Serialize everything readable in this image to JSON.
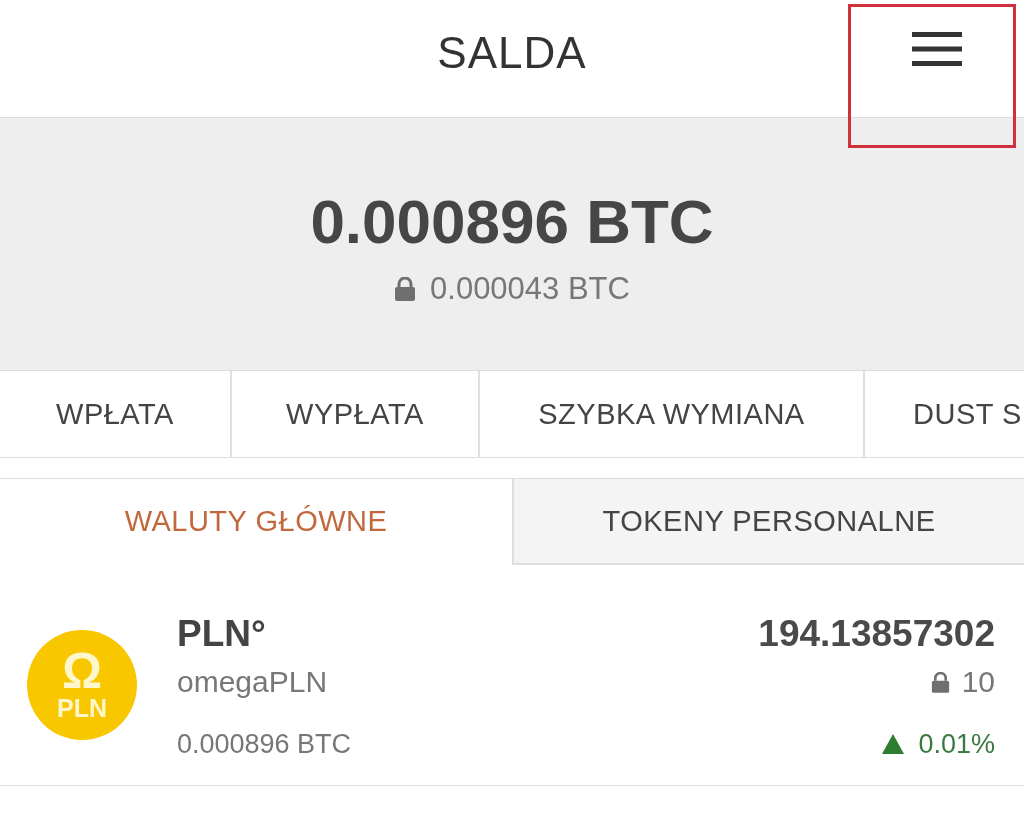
{
  "header": {
    "title": "SALDA",
    "menu_button": {
      "highlighted": true
    }
  },
  "balance": {
    "total": "0.000896 BTC",
    "locked": "0.000043 BTC"
  },
  "actions": [
    "WPŁATA",
    "WYPŁATA",
    "SZYBKA WYMIANA",
    "DUST S"
  ],
  "tabs": [
    {
      "label": "WALUTY GŁÓWNE",
      "selected": true
    },
    {
      "label": "TOKENY PERSONALNE",
      "selected": false
    }
  ],
  "assets": [
    {
      "logo": {
        "symbol": "Ω",
        "label": "PLN"
      },
      "symbol": "PLN°",
      "name": "omegaPLN",
      "value_btc": "0.000896 BTC",
      "amount": "194.13857302",
      "locked": "10",
      "change": {
        "rising": true,
        "value": "0.01%"
      }
    }
  ]
}
